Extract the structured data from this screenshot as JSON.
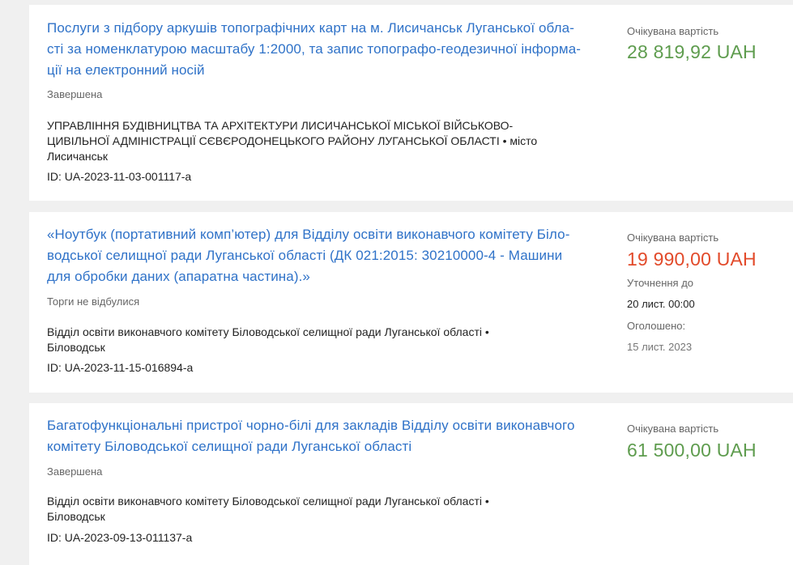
{
  "tenders": [
    {
      "title": "Послуги з підбору аркушів топографічних карт на м. Лисичанськ Луганської обла-сті за номенклатурою масштабу 1:2000, та запис топографо-геодезичної інформа-ції на електронний носій",
      "title_lines": [
        "Послуги з підбору аркушів топографічних карт на м. Лисичанськ Луганської обла-",
        "сті за номенклатурою масштабу 1:2000, та запис топографо-геодезичної інформа-",
        "ції на електронний носій"
      ],
      "status": "Завершена",
      "org_lines": [
        "УПРАВЛІННЯ БУДІВНИЦТВА ТА АРХІТЕКТУРИ ЛИСИЧАНСЬКОЇ МІСЬКОЇ ВІЙСЬКОВО-",
        "ЦИВІЛЬНОЇ АДМІНІСТРАЦІЇ СЄВЄРОДОНЕЦЬКОГО РАЙОНУ ЛУГАНСЬКОЇ ОБЛАСТІ • місто",
        "Лисичанськ"
      ],
      "id": "ID: UA-2023-11-03-001117-a",
      "price_label": "Очікувана вартість",
      "price": "28 819,92 UAH",
      "price_color": "#5e9c4e"
    },
    {
      "title_lines": [
        "«Ноутбук (портативний комп’ютер) для Відділу освіти виконавчого комітету Біло-",
        "водської селищної ради Луганської області (ДК 021:2015: 30210000-4 - Машини",
        "для обробки даних (апаратна частина).»"
      ],
      "status": "Торги не відбулися",
      "org_lines": [
        "Відділ освіти виконавчого комітету Біловодської селищної ради Луганської області •",
        "Біловодськ"
      ],
      "id": "ID: UA-2023-11-15-016894-a",
      "price_label": "Очікувана вартість",
      "price": "19 990,00 UAH",
      "price_color": "#e24a2a",
      "clarification_label": "Уточнення до",
      "clarification_value": "20 лист. 00:00",
      "announced_label": "Оголошено:",
      "announced_value": "15 лист. 2023"
    },
    {
      "title_lines": [
        "Багатофункціональні пристрої чорно-білі для закладів Відділу освіти виконавчого",
        "комітету Біловодської селищної ради Луганської області"
      ],
      "status": "Завершена",
      "org_lines": [
        "Відділ освіти виконавчого комітету Біловодської селищної ради Луганської області •",
        "Біловодськ"
      ],
      "id": "ID: UA-2023-09-13-011137-a",
      "price_label": "Очікувана вартість",
      "price": "61 500,00 UAH",
      "price_color": "#5e9c4e"
    }
  ]
}
